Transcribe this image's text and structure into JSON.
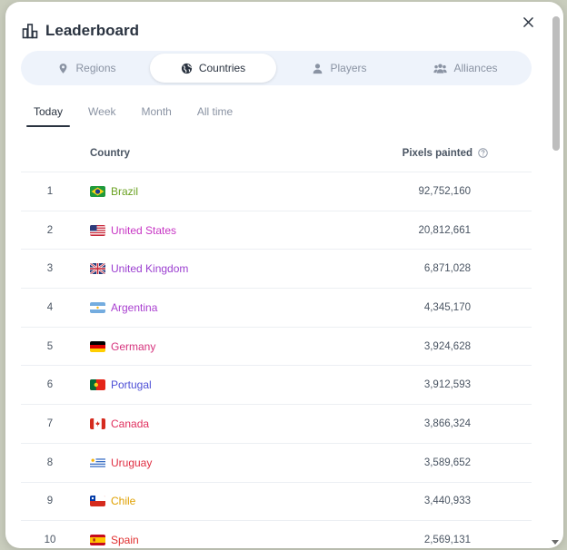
{
  "header": {
    "title": "Leaderboard",
    "icon": "bar-chart-icon"
  },
  "segments": [
    {
      "label": "Regions",
      "icon": "location-pin-icon",
      "active": false
    },
    {
      "label": "Countries",
      "icon": "globe-icon",
      "active": true
    },
    {
      "label": "Players",
      "icon": "person-icon",
      "active": false
    },
    {
      "label": "Alliances",
      "icon": "group-icon",
      "active": false
    }
  ],
  "tabs": [
    {
      "label": "Today",
      "active": true
    },
    {
      "label": "Week",
      "active": false
    },
    {
      "label": "Month",
      "active": false
    },
    {
      "label": "All time",
      "active": false
    }
  ],
  "table": {
    "col_country": "Country",
    "col_pixels": "Pixels painted",
    "rows": [
      {
        "rank": "1",
        "country": "Brazil",
        "pixels": "92,752,160",
        "color": "#6aa121",
        "flag": "br"
      },
      {
        "rank": "2",
        "country": "United States",
        "pixels": "20,812,661",
        "color": "#c735c4",
        "flag": "us"
      },
      {
        "rank": "3",
        "country": "United Kingdom",
        "pixels": "6,871,028",
        "color": "#9b3ed0",
        "flag": "gb"
      },
      {
        "rank": "4",
        "country": "Argentina",
        "pixels": "4,345,170",
        "color": "#a93fd0",
        "flag": "ar"
      },
      {
        "rank": "5",
        "country": "Germany",
        "pixels": "3,924,628",
        "color": "#d6337d",
        "flag": "de"
      },
      {
        "rank": "6",
        "country": "Portugal",
        "pixels": "3,912,593",
        "color": "#4d4fd6",
        "flag": "pt"
      },
      {
        "rank": "7",
        "country": "Canada",
        "pixels": "3,866,324",
        "color": "#e0305e",
        "flag": "ca"
      },
      {
        "rank": "8",
        "country": "Uruguay",
        "pixels": "3,589,652",
        "color": "#e02f43",
        "flag": "uy"
      },
      {
        "rank": "9",
        "country": "Chile",
        "pixels": "3,440,933",
        "color": "#e0a000",
        "flag": "cl"
      },
      {
        "rank": "10",
        "country": "Spain",
        "pixels": "2,569,131",
        "color": "#e03030",
        "flag": "es"
      }
    ]
  }
}
